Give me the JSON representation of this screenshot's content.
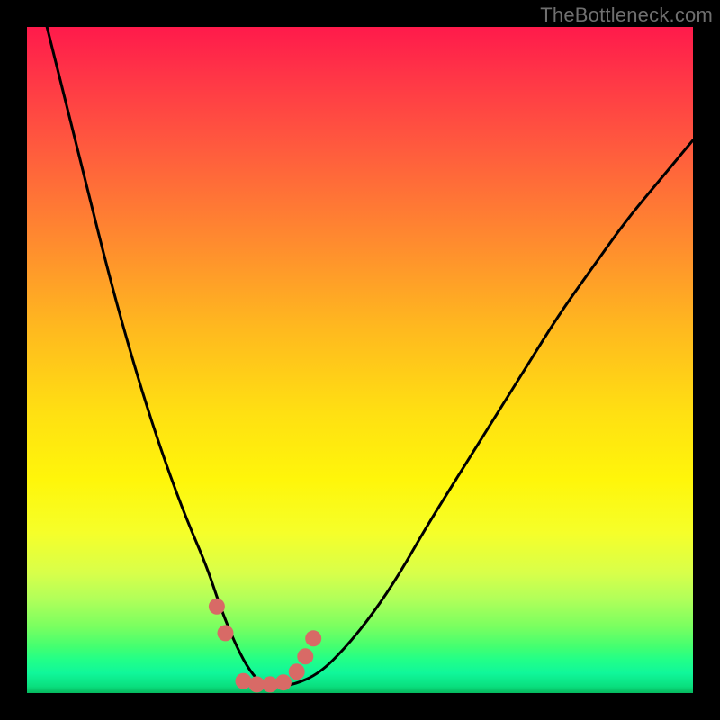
{
  "watermark": "TheBottleneck.com",
  "colors": {
    "background": "#000000",
    "curve_stroke": "#000000",
    "marker_fill": "#d86a66",
    "gradient_top": "#ff1a4b",
    "gradient_bottom": "#06b85e"
  },
  "chart_data": {
    "type": "line",
    "title": "",
    "xlabel": "",
    "ylabel": "",
    "xlim": [
      0,
      100
    ],
    "ylim": [
      0,
      100
    ],
    "note": "Values are relative percentages of plot-area width (x) and height (y, 0 = bottom, 100 = top). Curve is a V-shaped bottleneck profile; markers cluster near the minimum.",
    "series": [
      {
        "name": "bottleneck-curve",
        "x": [
          0,
          3,
          6,
          9,
          12,
          15,
          18,
          21,
          24,
          27,
          29,
          31,
          33,
          35,
          37,
          40,
          44,
          48,
          52,
          56,
          60,
          65,
          70,
          75,
          80,
          85,
          90,
          95,
          100
        ],
        "y": [
          112,
          100,
          88,
          76,
          64,
          53,
          43,
          34,
          26,
          19,
          13,
          8,
          4,
          1.5,
          1,
          1.2,
          3,
          7,
          12,
          18,
          25,
          33,
          41,
          49,
          57,
          64,
          71,
          77,
          83
        ]
      }
    ],
    "markers": [
      {
        "x": 28.5,
        "y": 13
      },
      {
        "x": 29.8,
        "y": 9
      },
      {
        "x": 32.5,
        "y": 1.8
      },
      {
        "x": 34.5,
        "y": 1.3
      },
      {
        "x": 36.5,
        "y": 1.3
      },
      {
        "x": 38.5,
        "y": 1.6
      },
      {
        "x": 40.5,
        "y": 3.2
      },
      {
        "x": 41.8,
        "y": 5.5
      },
      {
        "x": 43.0,
        "y": 8.2
      }
    ]
  }
}
